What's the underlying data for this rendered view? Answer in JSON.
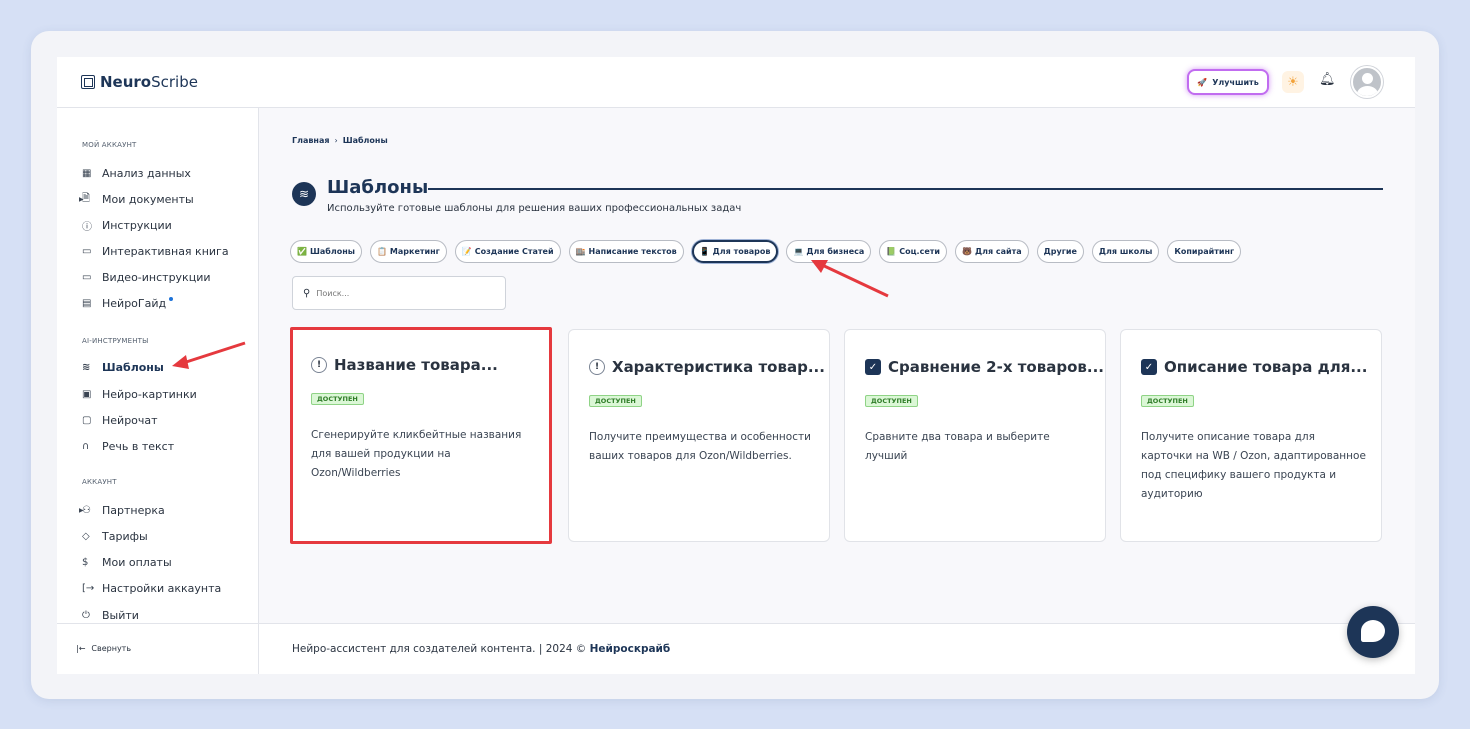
{
  "brand": {
    "name_bold": "Neuro",
    "name_rest": "Scribe"
  },
  "topbar": {
    "upgrade_label": "Улучшить"
  },
  "sidebar": {
    "section_account": "МОЙ АККАУНТ",
    "account_items": [
      {
        "icon": "grid-icon",
        "label": "Анализ данных"
      },
      {
        "icon": "document-icon",
        "label": "Мои документы"
      },
      {
        "icon": "help-circle-icon",
        "label": "Инструкции"
      },
      {
        "icon": "book-icon",
        "label": "Интерактивная книга"
      },
      {
        "icon": "video-icon",
        "label": "Видео-инструкции"
      },
      {
        "icon": "guide-icon",
        "label": "НейроГайд"
      }
    ],
    "section_ai": "AI-ИНСТРУМЕНТЫ",
    "ai_items": [
      {
        "icon": "layers-icon",
        "label": "Шаблоны"
      },
      {
        "icon": "image-icon",
        "label": "Нейро-картинки"
      },
      {
        "icon": "chat-icon",
        "label": "Нейрочат"
      },
      {
        "icon": "headphones-icon",
        "label": "Речь в текст"
      }
    ],
    "section_acc": "АККАУНТ",
    "acc_items": [
      {
        "icon": "users-icon",
        "label": "Партнерка"
      },
      {
        "icon": "tag-icon",
        "label": "Тарифы"
      },
      {
        "icon": "dollar-icon",
        "label": "Мои оплаты"
      },
      {
        "icon": "logout-arrow-icon",
        "label": "Настройки аккаунта"
      },
      {
        "icon": "power-icon",
        "label": "Выйти"
      }
    ],
    "collapse_label": "Свернуть"
  },
  "breadcrumb": {
    "home": "Главная",
    "current": "Шаблоны"
  },
  "page": {
    "title": "Шаблоны",
    "subtitle": "Используйте готовые шаблоны для решения ваших профессиональных задач"
  },
  "chips": [
    {
      "emoji": "✅",
      "label": "Шаблоны"
    },
    {
      "emoji": "📋",
      "label": "Маркетинг"
    },
    {
      "emoji": "📝",
      "label": "Создание Статей"
    },
    {
      "emoji": "🏬",
      "label": "Написание текстов"
    },
    {
      "emoji": "📱",
      "label": "Для товаров"
    },
    {
      "emoji": "💻",
      "label": "Для бизнеса"
    },
    {
      "emoji": "📗",
      "label": "Соц.сети"
    },
    {
      "emoji": "🐻",
      "label": "Для сайта"
    },
    {
      "emoji": "",
      "label": "Другие"
    },
    {
      "emoji": "",
      "label": "Для школы"
    },
    {
      "emoji": "",
      "label": "Копирайтинг"
    }
  ],
  "search": {
    "placeholder": "Поиск..."
  },
  "cards": [
    {
      "title": "Название товара...",
      "badge": "ДОСТУПЕН",
      "desc": "Сгенерируйте кликбейтные названия для вашей продукции на Ozon/Wildberries"
    },
    {
      "title": "Характеристика товар...",
      "badge": "ДОСТУПЕН",
      "desc": "Получите преимущества и особенности ваших товаров для Ozon/Wildberries."
    },
    {
      "title": "Сравнение 2-х товаров...",
      "badge": "ДОСТУПЕН",
      "desc": "Сравните два товара и выберите лучший"
    },
    {
      "title": "Описание товара для...",
      "badge": "ДОСТУПЕН",
      "desc": "Получите описание товара для карточки на WB / Ozon, адаптированное под специфику вашего продукта и аудиторию"
    }
  ],
  "footer": {
    "text": "Нейро-ассистент для создателей контента.  | 2024 © ",
    "link": "Нейроскрайб"
  },
  "colors": {
    "primary": "#1d3557",
    "highlight": "#e5393e",
    "badge_bg": "#dbf7d6",
    "upgrade_glow": "#c16cf0"
  }
}
